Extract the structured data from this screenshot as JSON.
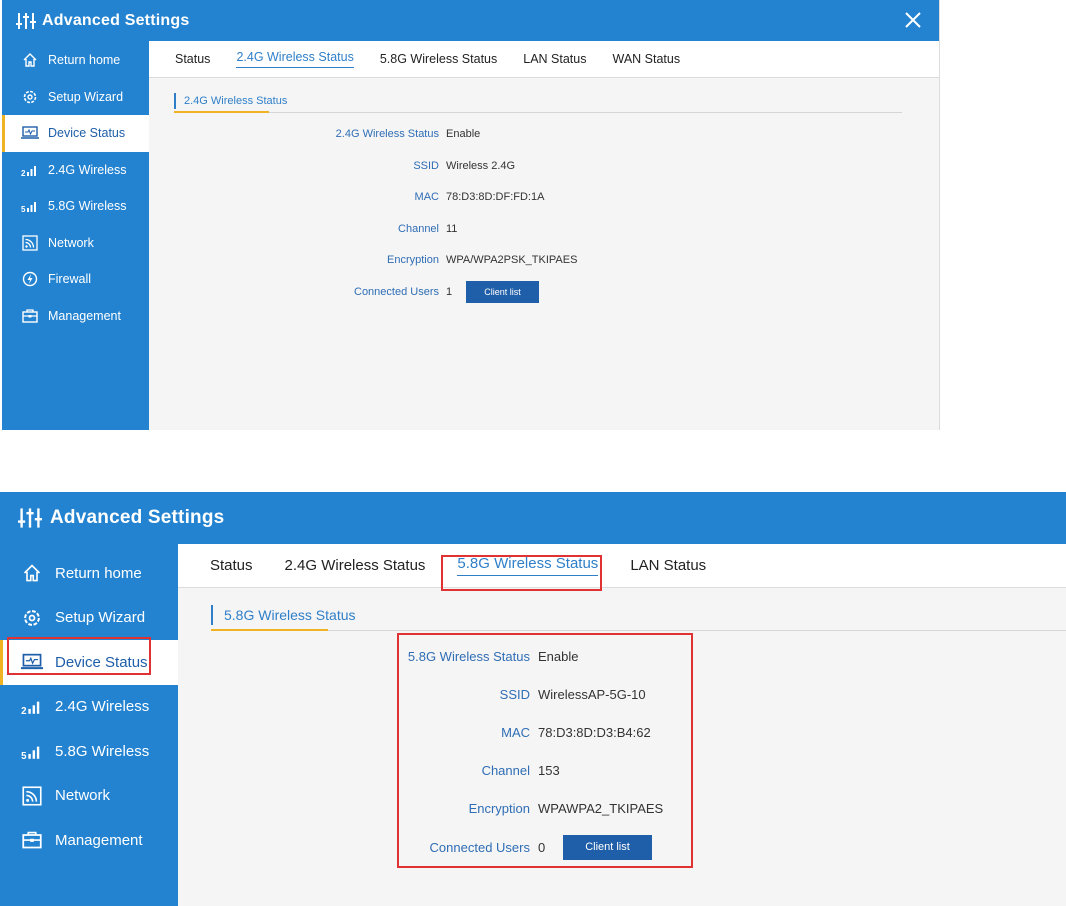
{
  "top": {
    "title": "Advanced Settings",
    "close_icon": "close-icon",
    "sidebar": [
      {
        "label": "Return home",
        "icon": "home-icon"
      },
      {
        "label": "Setup Wizard",
        "icon": "gear-icon"
      },
      {
        "label": "Device Status",
        "icon": "monitor-icon"
      },
      {
        "label": "2.4G Wireless",
        "icon": "signal-2g-icon"
      },
      {
        "label": "5.8G Wireless",
        "icon": "signal-5g-icon"
      },
      {
        "label": "Network",
        "icon": "rss-icon"
      },
      {
        "label": "Firewall",
        "icon": "shield-icon"
      },
      {
        "label": "Management",
        "icon": "toolbox-icon"
      }
    ],
    "active_sidebar": "Device Status",
    "tabs": [
      "Status",
      "2.4G Wireless Status",
      "5.8G Wireless Status",
      "LAN Status",
      "WAN Status"
    ],
    "active_tab": "2.4G Wireless Status",
    "section_title": "2.4G Wireless Status",
    "fields": [
      {
        "label": "2.4G Wireless Status",
        "value": "Enable"
      },
      {
        "label": "SSID",
        "value": "Wireless 2.4G"
      },
      {
        "label": "MAC",
        "value": "78:D3:8D:DF:FD:1A"
      },
      {
        "label": "Channel",
        "value": "11"
      },
      {
        "label": "Encryption",
        "value": "WPA/WPA2PSK_TKIPAES"
      },
      {
        "label": "Connected Users",
        "value": "1"
      }
    ],
    "button": "Client list"
  },
  "bottom": {
    "title": "Advanced Settings",
    "sidebar": [
      {
        "label": "Return home",
        "icon": "home-icon"
      },
      {
        "label": "Setup Wizard",
        "icon": "gear-icon"
      },
      {
        "label": "Device Status",
        "icon": "monitor-icon"
      },
      {
        "label": "2.4G Wireless",
        "icon": "signal-2g-icon"
      },
      {
        "label": "5.8G Wireless",
        "icon": "signal-5g-icon"
      },
      {
        "label": "Network",
        "icon": "rss-icon"
      },
      {
        "label": "Management",
        "icon": "toolbox-icon"
      }
    ],
    "active_sidebar": "Device Status",
    "tabs": [
      "Status",
      "2.4G Wireless Status",
      "5.8G Wireless Status",
      "LAN Status"
    ],
    "active_tab": "5.8G Wireless Status",
    "section_title": "5.8G Wireless Status",
    "fields": [
      {
        "label": "5.8G Wireless Status",
        "value": "Enable"
      },
      {
        "label": "SSID",
        "value": "WirelessAP-5G-10"
      },
      {
        "label": "MAC",
        "value": "78:D3:8D:D3:B4:62"
      },
      {
        "label": "Channel",
        "value": "153"
      },
      {
        "label": "Encryption",
        "value": "WPAWPA2_TKIPAES"
      },
      {
        "label": "Connected Users",
        "value": "0"
      }
    ],
    "button": "Client list"
  },
  "colors": {
    "primary": "#2383d0",
    "active_text": "#1f5ea8",
    "accent": "#f0b323",
    "highlight": "#e03232",
    "button": "#1f5ea8"
  }
}
